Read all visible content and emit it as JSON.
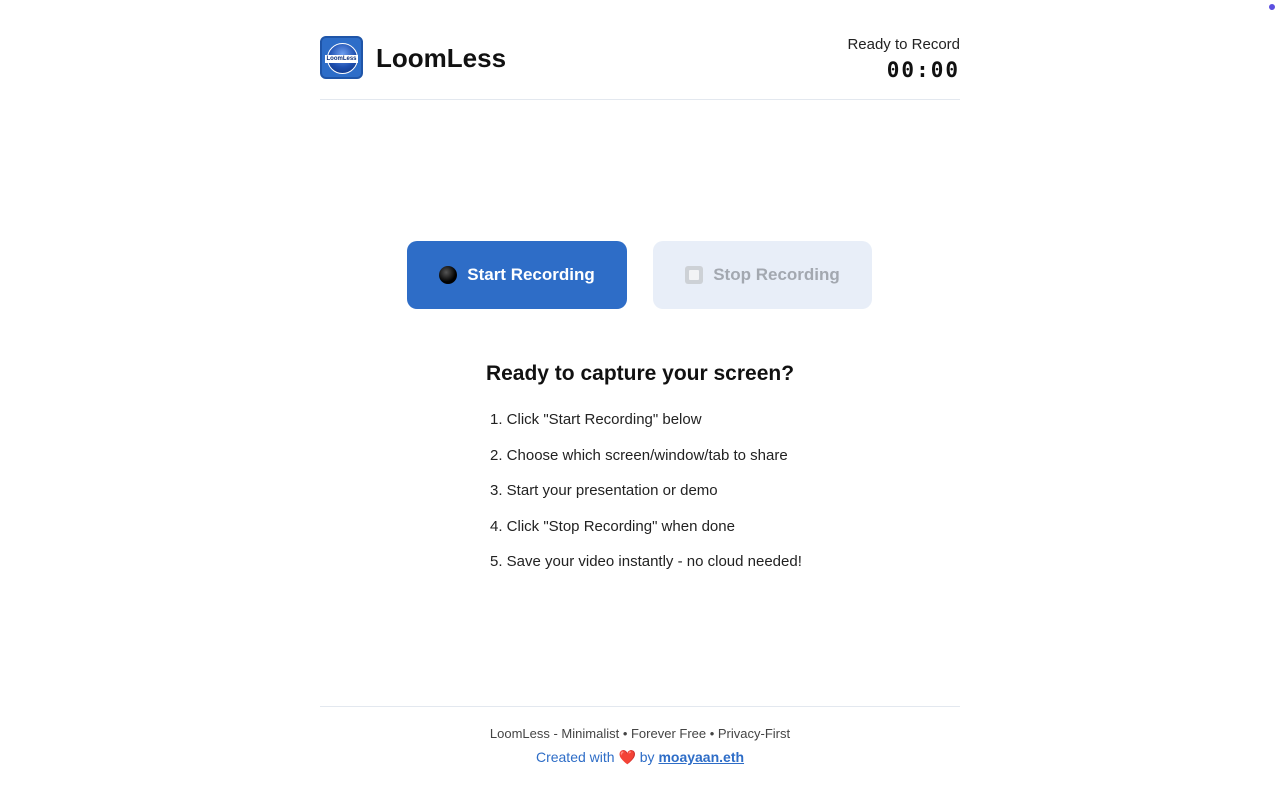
{
  "app": {
    "name": "LoomLess",
    "logo_text": "LoomLess"
  },
  "status": {
    "label": "Ready to Record",
    "timer": "00:00"
  },
  "controls": {
    "start_label": "Start Recording",
    "stop_label": "Stop Recording"
  },
  "instructions": {
    "title": "Ready to capture your screen?",
    "steps": [
      "1. Click \"Start Recording\" below",
      "2. Choose which screen/window/tab to share",
      "3. Start your presentation or demo",
      "4. Click \"Stop Recording\" when done",
      "5. Save your video instantly - no cloud needed!"
    ]
  },
  "footer": {
    "tagline": "LoomLess - Minimalist • Forever Free • Privacy-First",
    "created_with": "Created with",
    "heart": "❤️",
    "by": "by",
    "author": "moayaan.eth"
  },
  "colors": {
    "accent": "#2e6dc7",
    "stop_bg": "#e8eef8",
    "corner_dot": "#5b4fe0"
  }
}
